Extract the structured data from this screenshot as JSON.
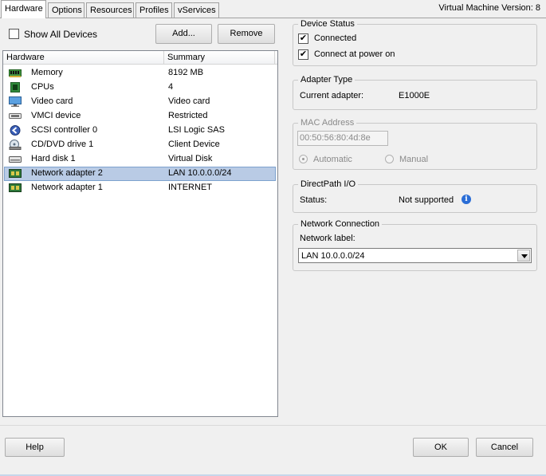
{
  "tabs": [
    {
      "label": "Hardware",
      "active": true
    },
    {
      "label": "Options"
    },
    {
      "label": "Resources"
    },
    {
      "label": "Profiles"
    },
    {
      "label": "vServices"
    }
  ],
  "vm_version": "Virtual Machine Version: 8",
  "show_all_devices": {
    "label": "Show All Devices",
    "checked": false
  },
  "buttons": {
    "add": "Add...",
    "remove": "Remove",
    "help": "Help",
    "ok": "OK",
    "cancel": "Cancel"
  },
  "hardware_table": {
    "columns": [
      "Hardware",
      "Summary"
    ],
    "rows": [
      {
        "name": "Memory",
        "summary": "8192 MB",
        "icon": "memory-icon"
      },
      {
        "name": "CPUs",
        "summary": "4",
        "icon": "cpu-icon"
      },
      {
        "name": "Video card",
        "summary": "Video card",
        "icon": "monitor-icon"
      },
      {
        "name": "VMCI device",
        "summary": "Restricted",
        "icon": "vmci-icon"
      },
      {
        "name": "SCSI controller 0",
        "summary": "LSI Logic SAS",
        "icon": "scsi-controller-icon"
      },
      {
        "name": "CD/DVD drive 1",
        "summary": "Client Device",
        "icon": "cd-dvd-icon"
      },
      {
        "name": "Hard disk 1",
        "summary": "Virtual Disk",
        "icon": "hard-disk-icon"
      },
      {
        "name": "Network adapter 2",
        "summary": "LAN 10.0.0.0/24",
        "icon": "network-adapter-icon",
        "selected": true
      },
      {
        "name": "Network adapter 1",
        "summary": "INTERNET",
        "icon": "network-adapter-icon"
      }
    ]
  },
  "device_status": {
    "title": "Device Status",
    "connected": {
      "label": "Connected",
      "checked": true
    },
    "connect_at_power_on": {
      "label": "Connect at power on",
      "checked": true
    }
  },
  "adapter_type": {
    "title": "Adapter Type",
    "label": "Current adapter:",
    "value": "E1000E"
  },
  "mac_address": {
    "title": "MAC Address",
    "value": "00:50:56:80:4d:8e",
    "automatic": "Automatic",
    "manual": "Manual"
  },
  "directpath": {
    "title": "DirectPath I/O",
    "status_label": "Status:",
    "status_value": "Not supported"
  },
  "network_connection": {
    "title": "Network Connection",
    "label": "Network label:",
    "selected": "LAN 10.0.0.0/24"
  },
  "colors": {
    "selection": "#b9cbe5",
    "info": "#2a6dd6"
  }
}
